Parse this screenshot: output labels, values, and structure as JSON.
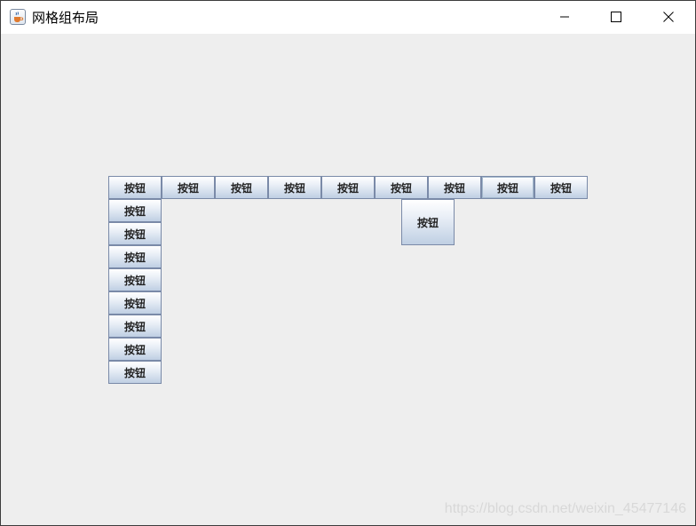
{
  "window": {
    "title": "网格组布局",
    "app_icon": "java-cup-icon",
    "controls": {
      "minimize_icon": "minimize-icon",
      "maximize_icon": "maximize-icon",
      "close_icon": "close-icon"
    }
  },
  "buttons": {
    "top_row": [
      "按钮",
      "按钮",
      "按钮",
      "按钮",
      "按钮",
      "按钮",
      "按钮",
      "按钮",
      "按钮"
    ],
    "tall": "按钮",
    "left_column": [
      "按钮",
      "按钮",
      "按钮",
      "按钮",
      "按钮",
      "按钮",
      "按钮",
      "按钮"
    ]
  },
  "watermark": "https://blog.csdn.net/weixin_45477146",
  "colors": {
    "title_bar": "#ffffff",
    "content_bg": "#eeeeee",
    "button_border": "#7a8aa8",
    "button_gradient_top": "#ffffff",
    "button_gradient_bottom": "#bfcfe3"
  }
}
